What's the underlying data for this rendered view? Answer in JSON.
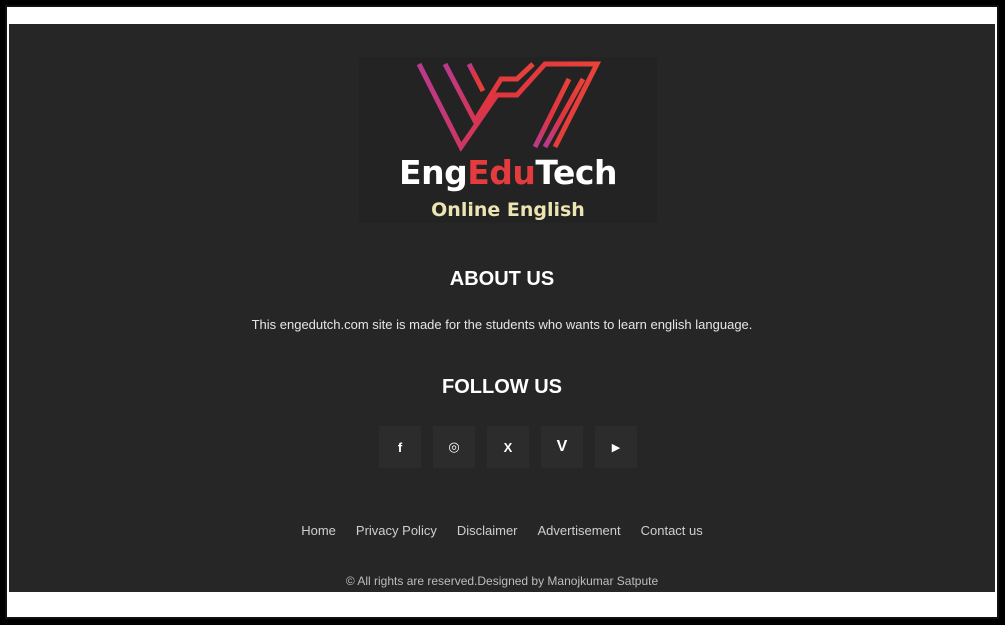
{
  "brand": {
    "name_part1": "Eng",
    "name_part2": "Edu",
    "name_part3": "Tech",
    "tagline": "Online English",
    "colors": {
      "accent": "#e43b3f",
      "magenta": "#c0307a",
      "tagline": "#ece4b2"
    }
  },
  "about": {
    "title": "ABOUT US",
    "text": "This engedutch.com site is made for the students who wants to learn english language."
  },
  "follow": {
    "title": "FOLLOW US",
    "icons": [
      "facebook-icon",
      "instagram-icon",
      "x-icon",
      "vimeo-icon",
      "youtube-icon"
    ],
    "glyphs": {
      "facebook": "f",
      "instagram": "◎",
      "x": "X",
      "vimeo": "V",
      "youtube": "▶"
    }
  },
  "nav": {
    "home": "Home",
    "privacy": "Privacy Policy",
    "disclaimer": "Disclaimer",
    "advertisement": "Advertisement",
    "contact": "Contact us"
  },
  "footer": {
    "copyright": "© All rights are reserved.Designed by Manojkumar Satpute"
  }
}
